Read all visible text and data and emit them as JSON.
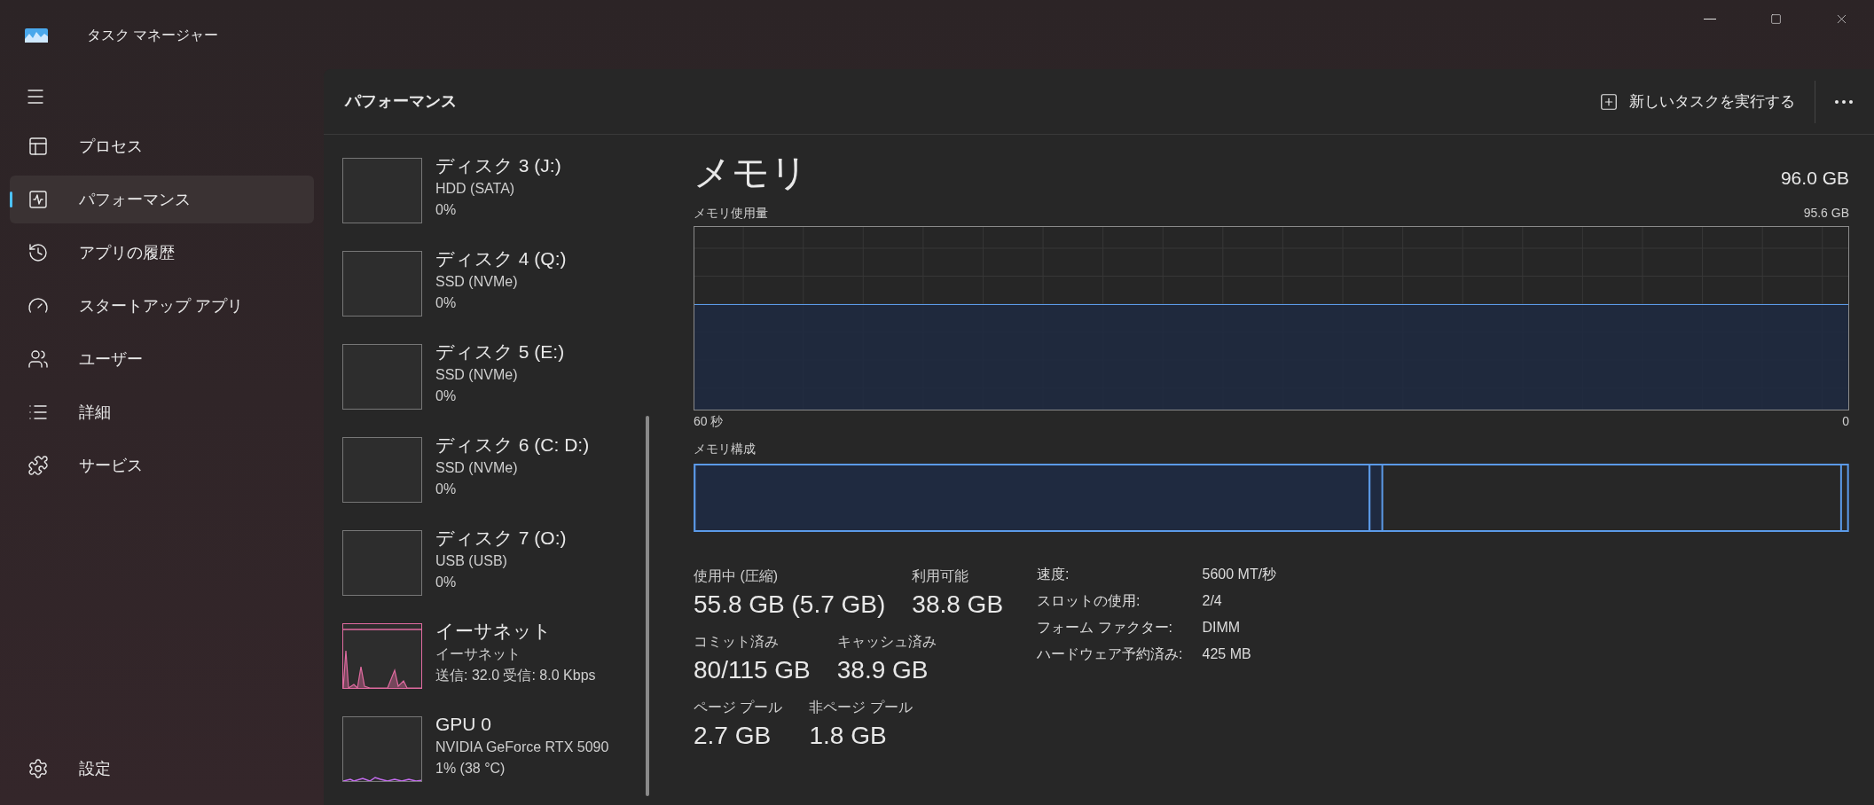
{
  "window": {
    "title": "タスク マネージャー"
  },
  "sidebar": {
    "items": [
      {
        "label": "プロセス",
        "selected": false
      },
      {
        "label": "パフォーマンス",
        "selected": true
      },
      {
        "label": "アプリの履歴",
        "selected": false
      },
      {
        "label": "スタートアップ アプリ",
        "selected": false
      },
      {
        "label": "ユーザー",
        "selected": false
      },
      {
        "label": "詳細",
        "selected": false
      },
      {
        "label": "サービス",
        "selected": false
      }
    ],
    "footer": {
      "label": "設定"
    }
  },
  "header": {
    "title": "パフォーマンス",
    "run_task": "新しいタスクを実行する"
  },
  "devices": [
    {
      "kind": "disk",
      "name": "ディスク 3 (J:)",
      "type": "HDD (SATA)",
      "value": "0%"
    },
    {
      "kind": "disk",
      "name": "ディスク 4 (Q:)",
      "type": "SSD (NVMe)",
      "value": "0%"
    },
    {
      "kind": "disk",
      "name": "ディスク 5 (E:)",
      "type": "SSD (NVMe)",
      "value": "0%"
    },
    {
      "kind": "disk",
      "name": "ディスク 6 (C: D:)",
      "type": "SSD (NVMe)",
      "value": "0%"
    },
    {
      "kind": "disk",
      "name": "ディスク 7 (O:)",
      "type": "USB (USB)",
      "value": "0%"
    },
    {
      "kind": "ethernet",
      "name": "イーサネット",
      "type": "イーサネット",
      "value": "送信: 32.0  受信: 8.0 Kbps"
    },
    {
      "kind": "gpu",
      "name": "GPU 0",
      "type": "NVIDIA GeForce RTX 5090",
      "value": "1%  (38 °C)"
    }
  ],
  "memory": {
    "title": "メモリ",
    "total": "96.0 GB",
    "usage_label": "メモリ使用量",
    "usage_max": "95.6 GB",
    "time_start": "60 秒",
    "time_end": "0",
    "composition_label": "メモリ構成",
    "stats": [
      [
        {
          "label": "使用中 (圧縮)",
          "value": "55.8 GB (5.7 GB)"
        },
        {
          "label": "利用可能",
          "value": "38.8 GB"
        }
      ],
      [
        {
          "label": "コミット済み",
          "value": "80/115 GB"
        },
        {
          "label": "キャッシュ済み",
          "value": "38.9 GB"
        }
      ],
      [
        {
          "label": "ページ プール",
          "value": "2.7 GB"
        },
        {
          "label": "非ページ プール",
          "value": "1.8 GB"
        }
      ]
    ],
    "details": [
      {
        "label": "速度:",
        "value": "5600 MT/秒"
      },
      {
        "label": "スロットの使用:",
        "value": "2/4"
      },
      {
        "label": "フォーム ファクター:",
        "value": "DIMM"
      },
      {
        "label": "ハードウェア予約済み:",
        "value": "425 MB"
      }
    ]
  }
}
